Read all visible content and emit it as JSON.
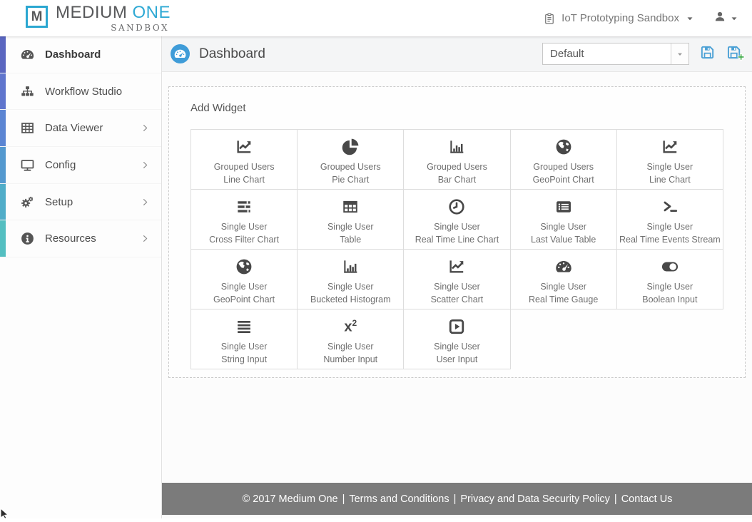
{
  "brand": {
    "logo_letter": "M",
    "name_primary": "MEDIUM",
    "name_accent": "ONE",
    "subtitle": "SANDBOX",
    "accent_color": "#2fa9d4"
  },
  "topbar": {
    "sandbox_label": "IoT Prototyping Sandbox",
    "sandbox_icon": "clipboard",
    "account_icon": "user"
  },
  "sidebar": {
    "items": [
      {
        "label": "Dashboard",
        "icon": "gauge",
        "active": true,
        "has_submenu": false,
        "strip_color": "#5a66c0"
      },
      {
        "label": "Workflow Studio",
        "icon": "sitemap",
        "active": false,
        "has_submenu": false,
        "strip_color": "#5f75cd"
      },
      {
        "label": "Data Viewer",
        "icon": "table-grid",
        "active": false,
        "has_submenu": true,
        "strip_color": "#5b85d3"
      },
      {
        "label": "Config",
        "icon": "desktop",
        "active": false,
        "has_submenu": true,
        "strip_color": "#5499cf"
      },
      {
        "label": "Setup",
        "icon": "gears",
        "active": false,
        "has_submenu": true,
        "strip_color": "#50adc9"
      },
      {
        "label": "Resources",
        "icon": "info",
        "active": false,
        "has_submenu": true,
        "strip_color": "#54bfc1"
      }
    ]
  },
  "page_header": {
    "title": "Dashboard",
    "title_icon": "gauge",
    "title_icon_bg": "#3f9cd8",
    "preset_select": {
      "value": "Default"
    },
    "actions": {
      "save_icon_color": "#4aa0d5",
      "save_plus_color": "#3aa845"
    }
  },
  "widget_panel": {
    "title": "Add Widget",
    "columns": 5,
    "items": [
      {
        "group": "Grouped Users",
        "label": "Line Chart",
        "icon": "chart-line"
      },
      {
        "group": "Grouped Users",
        "label": "Pie Chart",
        "icon": "pie-chart"
      },
      {
        "group": "Grouped Users",
        "label": "Bar Chart",
        "icon": "bar-chart"
      },
      {
        "group": "Grouped Users",
        "label": "GeoPoint Chart",
        "icon": "globe"
      },
      {
        "group": "Single User",
        "label": "Line Chart",
        "icon": "chart-line"
      },
      {
        "group": "Single User",
        "label": "Cross Filter Chart",
        "icon": "cross-filter"
      },
      {
        "group": "Single User",
        "label": "Table",
        "icon": "table"
      },
      {
        "group": "Single User",
        "label": "Real Time Line Chart",
        "icon": "clock"
      },
      {
        "group": "Single User",
        "label": "Last Value Table",
        "icon": "list-alt"
      },
      {
        "group": "Single User",
        "label": "Real Time Events Stream",
        "icon": "terminal"
      },
      {
        "group": "Single User",
        "label": "GeoPoint Chart",
        "icon": "globe"
      },
      {
        "group": "Single User",
        "label": "Bucketed Histogram",
        "icon": "bar-chart"
      },
      {
        "group": "Single User",
        "label": "Scatter Chart",
        "icon": "chart-line"
      },
      {
        "group": "Single User",
        "label": "Real Time Gauge",
        "icon": "gauge"
      },
      {
        "group": "Single User",
        "label": "Boolean Input",
        "icon": "toggle"
      },
      {
        "group": "Single User",
        "label": "String Input",
        "icon": "align-justify"
      },
      {
        "group": "Single User",
        "label": "Number Input",
        "icon": "number"
      },
      {
        "group": "Single User",
        "label": "User Input",
        "icon": "play-square"
      }
    ]
  },
  "footer": {
    "copyright": "© 2017 Medium One",
    "links": [
      "Terms and Conditions",
      "Privacy and Data Security Policy",
      "Contact Us"
    ],
    "divider": "|",
    "bg_color": "#7b7b7b"
  }
}
